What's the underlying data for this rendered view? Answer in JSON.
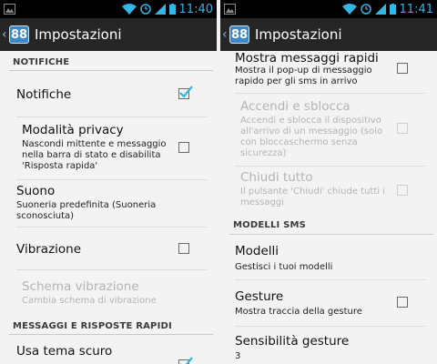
{
  "status_bar": {
    "left_time": "11:40",
    "right_time": "11:41",
    "accent": "#33b5e5",
    "icons": [
      "image-icon",
      "wifi-icon",
      "sync-icon",
      "signal-icon",
      "battery-icon"
    ]
  },
  "action_bar": {
    "app_icon_text": "88",
    "title": "Impostazioni"
  },
  "left": {
    "cat_notifiche": "NOTIFICHE",
    "notifiche": {
      "title": "Notifiche",
      "checked": true
    },
    "privacy": {
      "title": "Modalità privacy",
      "summary": "Nascondi mittente e messaggio nella barra di stato e disabilita 'Risposta rapida'",
      "checked": false
    },
    "suono": {
      "title": "Suono",
      "summary": "Suoneria predefinita (Suoneria sconosciuta)"
    },
    "vibrazione": {
      "title": "Vibrazione",
      "checked": false
    },
    "schema": {
      "title": "Schema vibrazione",
      "summary": "Cambia schema di vibrazione",
      "enabled": false
    },
    "cat_messaggi": "MESSAGGI E RISPOSTE RAPIDI",
    "tema": {
      "title": "Usa tema scuro",
      "checked": true
    }
  },
  "right": {
    "mostra": {
      "title": "Mostra messaggi rapidi",
      "summary": "Mostra il pop-up di messaggio rapido per gli sms in arrivo",
      "checked": false
    },
    "accendi": {
      "title": "Accendi e sblocca",
      "summary": "Accendi e sblocca il dispositivo all'arrivo di un messaggio (solo con bloccaschermo senza sicurezza)",
      "enabled": false
    },
    "chiudi": {
      "title": "Chiudi tutto",
      "summary": "Il pulsante 'Chiudi' chiude tutti i messaggi",
      "enabled": false
    },
    "cat_modelli": "MODELLI SMS",
    "modelli": {
      "title": "Modelli",
      "summary": "Gestisci i tuoi modelli"
    },
    "gesture": {
      "title": "Gesture",
      "summary": "Mostra traccia della gesture",
      "checked": false
    },
    "sensibilita": {
      "title": "Sensibilità gesture",
      "summary": "3"
    }
  }
}
